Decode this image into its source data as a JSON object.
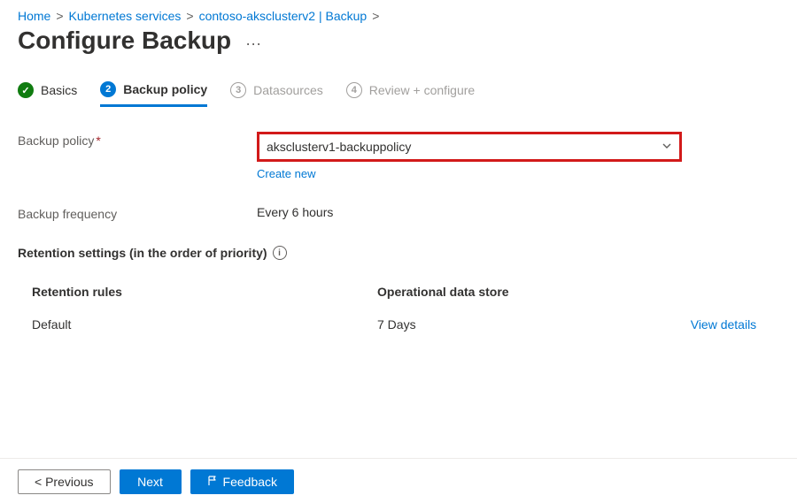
{
  "breadcrumb": {
    "items": [
      "Home",
      "Kubernetes services",
      "contoso-aksclusterv2 | Backup"
    ],
    "sep": ">"
  },
  "title": "Configure Backup",
  "more": "···",
  "steps": {
    "s1": {
      "num": "✓",
      "label": "Basics"
    },
    "s2": {
      "num": "2",
      "label": "Backup policy"
    },
    "s3": {
      "num": "3",
      "label": "Datasources"
    },
    "s4": {
      "num": "4",
      "label": "Review + configure"
    }
  },
  "form": {
    "policy_label": "Backup policy",
    "policy_req": "*",
    "policy_value": "aksclusterv1-backuppolicy",
    "create_new": "Create new",
    "freq_label": "Backup frequency",
    "freq_value": "Every 6 hours"
  },
  "retention": {
    "title": "Retention settings (in the order of priority)",
    "info": "i",
    "header_rules": "Retention rules",
    "header_store": "Operational data store",
    "rows": [
      {
        "rule": "Default",
        "store": "7 Days",
        "action": "View details"
      }
    ]
  },
  "footer": {
    "previous": "<  Previous",
    "next": "Next",
    "feedback": "Feedback"
  }
}
